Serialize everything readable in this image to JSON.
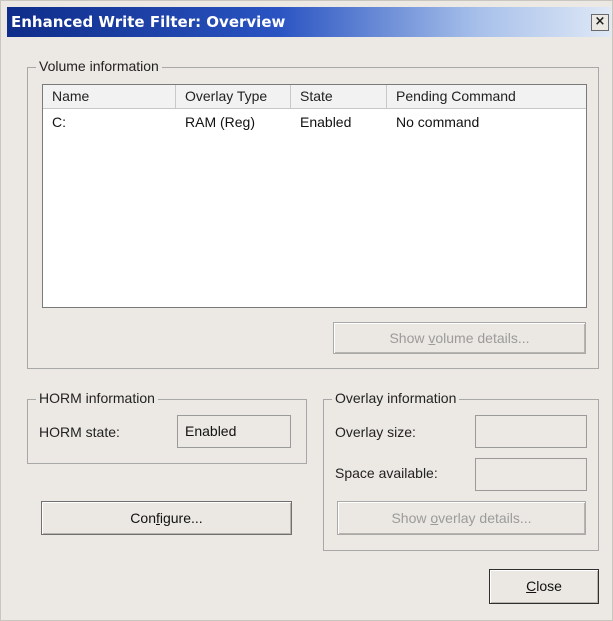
{
  "window": {
    "title": "Enhanced Write Filter: Overview",
    "close_glyph": "×"
  },
  "volume": {
    "group_label": "Volume information",
    "columns": [
      "Name",
      "Overlay Type",
      "State",
      "Pending Command"
    ],
    "rows": [
      [
        "C:",
        "RAM (Reg)",
        "Enabled",
        "No command"
      ]
    ],
    "details_button": {
      "pre": "Show ",
      "accel": "v",
      "post": "olume details..."
    }
  },
  "horm": {
    "group_label": "HORM information",
    "state_label": "HORM state:",
    "state_value": "Enabled"
  },
  "overlay": {
    "group_label": "Overlay information",
    "size_label": "Overlay size:",
    "size_value": "",
    "space_label": "Space available:",
    "space_value": "",
    "details_button": {
      "pre": "Show ",
      "accel": "o",
      "post": "verlay details..."
    }
  },
  "buttons": {
    "configure": {
      "pre": "Con",
      "accel": "f",
      "post": "igure..."
    },
    "close": {
      "pre": "",
      "accel": "C",
      "post": "lose"
    }
  }
}
